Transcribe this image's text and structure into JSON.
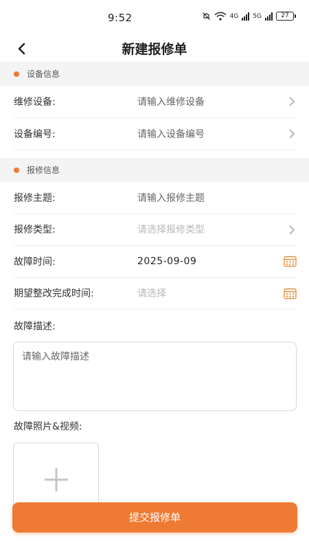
{
  "status": {
    "time": "9:52",
    "battery": "27",
    "net1": "4G",
    "net2": "5G"
  },
  "nav": {
    "title": "新建报修单"
  },
  "equipment_section": {
    "title": "设备信息",
    "rows": [
      {
        "label": "维修设备:",
        "placeholder": "请输入维修设备"
      },
      {
        "label": "设备编号:",
        "placeholder": "请输入设备编号"
      }
    ]
  },
  "repair_section": {
    "title": "报修信息",
    "subject": {
      "label": "报修主题:",
      "placeholder": "请输入报修主题"
    },
    "type": {
      "label": "报修类型:",
      "placeholder": "请选择报修类型"
    },
    "fault_time": {
      "label": "故障时间:",
      "value": "2025-09-09"
    },
    "expected_time": {
      "label": "期望整改完成时间:",
      "placeholder": "请选择"
    },
    "description": {
      "label": "故障描述:",
      "placeholder": "请输入故障描述"
    },
    "media": {
      "label": "故障照片&视频:"
    }
  },
  "submit_label": "提交报修单",
  "colors": {
    "accent": "#ef7a33",
    "section_bg": "#f4f4f4"
  }
}
